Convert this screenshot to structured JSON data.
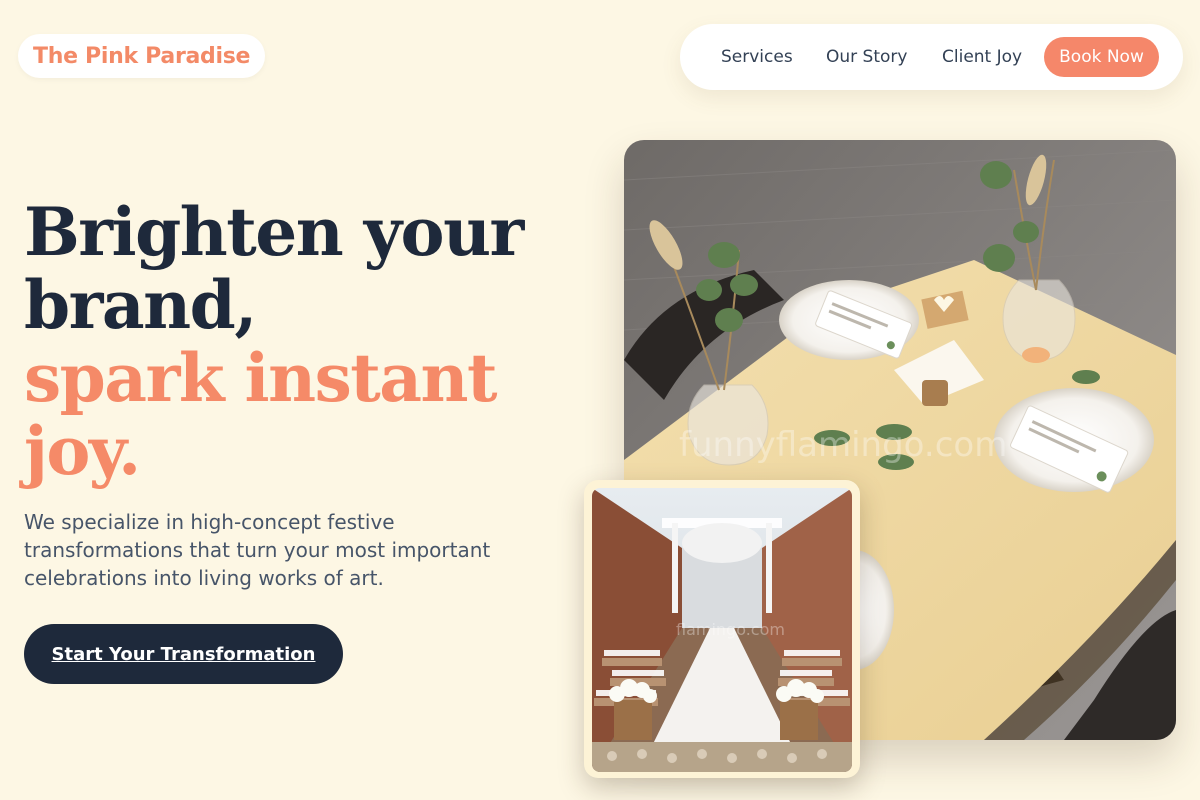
{
  "brand": {
    "name": "The Pink Paradise"
  },
  "nav": {
    "items": [
      {
        "label": "Services"
      },
      {
        "label": "Our Story"
      },
      {
        "label": "Client Joy"
      }
    ],
    "book_label": "Book Now"
  },
  "hero": {
    "title_dark": [
      "Brighten your",
      "brand,"
    ],
    "title_accent": [
      "spark instant",
      "joy."
    ],
    "description": "We specialize in high-concept festive transformations that turn your most important celebrations into living works of art.",
    "cta_label": "Start Your Transformation"
  },
  "images": {
    "main": {
      "watermark": "funnyflamingo.com"
    },
    "secondary": {
      "watermark": "flamingo.com"
    }
  },
  "colors": {
    "background": "#fdf7e4",
    "accent": "#f58a68",
    "dark": "#1e293b",
    "text_muted": "#475569"
  }
}
